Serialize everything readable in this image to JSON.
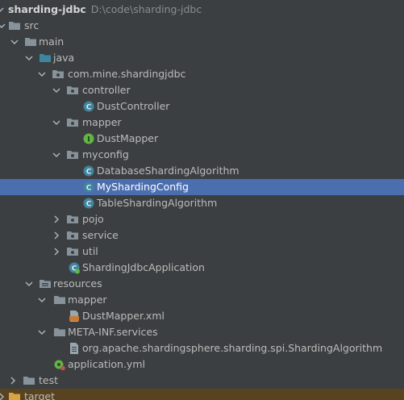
{
  "project": {
    "name": "sharding-jdbc",
    "path": "D:\\code\\sharding-jdbc"
  },
  "colors": {
    "background": "#3c3f41",
    "selection": "#4b6eaf",
    "folder": "#87939a",
    "class_icon": "#3e86a0",
    "interface_icon": "#62b543",
    "excluded_folder": "#d9a343",
    "excluded_row": "#57431f"
  },
  "tree": {
    "src": "src",
    "main": "main",
    "java": "java",
    "package": "com.mine.shardingjdbc",
    "controller": "controller",
    "dust_controller": "DustController",
    "mapper": "mapper",
    "dust_mapper": "DustMapper",
    "myconfig": "myconfig",
    "database_sharding_algorithm": "DatabaseShardingAlgorithm",
    "my_sharding_config": "MyShardingConfig",
    "table_sharding_algorithm": "TableShardingAlgorithm",
    "pojo": "pojo",
    "service": "service",
    "util": "util",
    "application_class": "ShardingJdbcApplication",
    "resources": "resources",
    "resources_mapper": "mapper",
    "dust_mapper_xml": "DustMapper.xml",
    "meta_inf_services": "META-INF.services",
    "spi_file": "org.apache.shardingsphere.sharding.spi.ShardingAlgorithm",
    "application_yml": "application.yml",
    "test": "test",
    "target": "target"
  },
  "icon_letters": {
    "class": "C",
    "interface": "I"
  }
}
